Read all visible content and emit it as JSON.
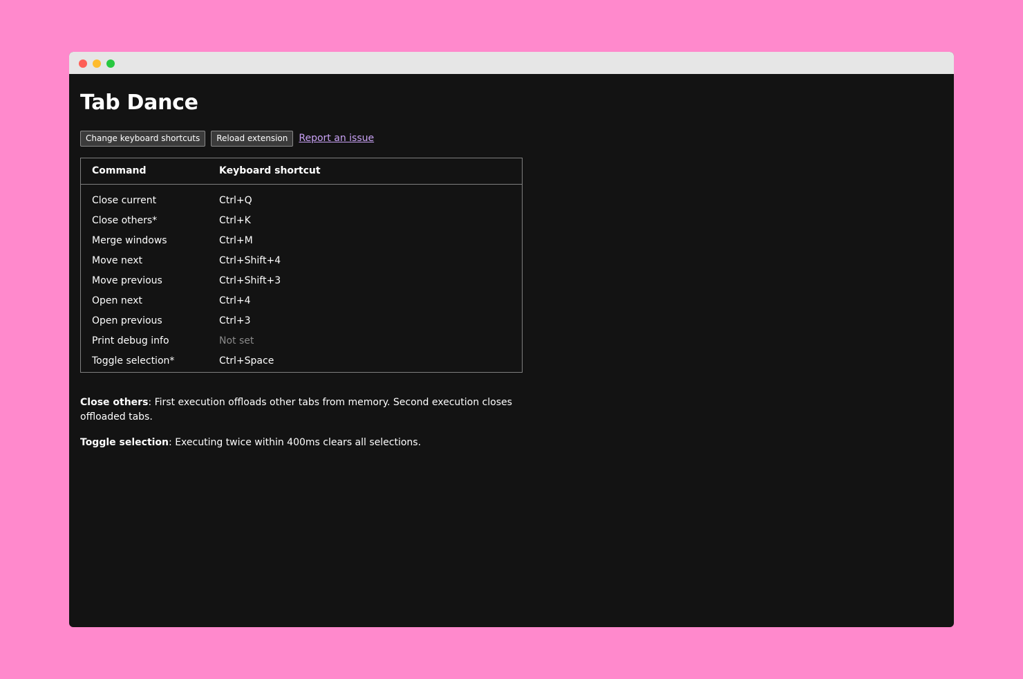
{
  "colors": {
    "background": "#ff89cc",
    "window_bg": "#131313",
    "titlebar": "#e6e6e6",
    "link": "#c9a2f5",
    "muted": "#8a8a8a"
  },
  "window": {
    "controls": [
      "close-dot",
      "minimize-dot",
      "maximize-dot"
    ]
  },
  "page": {
    "title": "Tab Dance"
  },
  "actions": {
    "change_shortcuts_label": "Change keyboard shortcuts",
    "reload_label": "Reload extension",
    "report_label": "Report an issue"
  },
  "table": {
    "headers": [
      "Command",
      "Keyboard shortcut"
    ],
    "rows": [
      {
        "command": "Close current",
        "shortcut": "Ctrl+Q"
      },
      {
        "command": "Close others*",
        "shortcut": "Ctrl+K"
      },
      {
        "command": "Merge windows",
        "shortcut": "Ctrl+M"
      },
      {
        "command": "Move next",
        "shortcut": "Ctrl+Shift+4"
      },
      {
        "command": "Move previous",
        "shortcut": "Ctrl+Shift+3"
      },
      {
        "command": "Open next",
        "shortcut": "Ctrl+4"
      },
      {
        "command": "Open previous",
        "shortcut": "Ctrl+3"
      },
      {
        "command": "Print debug info",
        "shortcut": "Not set"
      },
      {
        "command": "Toggle selection*",
        "shortcut": "Ctrl+Space"
      }
    ]
  },
  "notes": [
    {
      "term": "Close others",
      "text": ": First execution offloads other tabs from memory. Second execution closes offloaded tabs."
    },
    {
      "term": "Toggle selection",
      "text": ": Executing twice within 400ms clears all selections."
    }
  ]
}
